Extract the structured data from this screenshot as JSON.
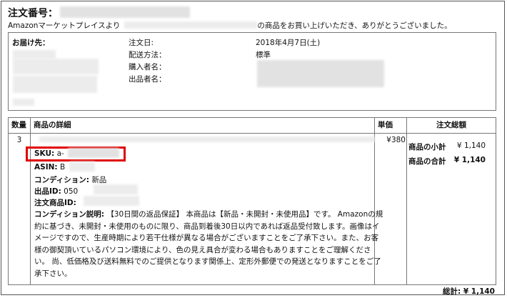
{
  "header": {
    "order_number_label": "注文番号：",
    "thanks_prefix": "Amazonマーケットプレイスより",
    "thanks_suffix": "の商品をお買い上げいただき、ありがとうございました。"
  },
  "shipping": {
    "ship_to_label": "お届け先：",
    "order_date_label": "注文日:",
    "order_date_value": "2018年4月7日(土)",
    "shipping_method_label": "配送方法：",
    "shipping_method_value": "標準",
    "purchaser_label": "購入者名：",
    "seller_label": "出品者名："
  },
  "table": {
    "headers": {
      "qty": "数量",
      "detail": "商品の詳細",
      "unit_price": "単価",
      "total": "注文総額"
    },
    "row": {
      "qty": "3",
      "unit_price": "¥380",
      "sku_label": "SKU:",
      "sku_value": "a-",
      "asin_label": "ASIN:",
      "asin_value": "B",
      "condition_label": "コンディション:",
      "condition_value": "新品",
      "listing_id_label": "出品ID:",
      "listing_id_value": "050",
      "order_item_id_label": "注文商品ID:",
      "condition_desc_label": "コンディション説明:",
      "condition_desc_text": "【30日間の返品保証】 本商品は【新品・未開封・未使用品】です。 Amazonの規約に基づき、未開封・未使用のものに限り、商品到着後30日以内であれば返品受付致します。画像はイメージですので、生産時期により若干仕様が異なる場合がございますことをご了承下さい。また、お客様の御契頂いているパソコン環境により、色の見え具合が変わる場合もありますことをご理解ください。 尚、低価格及び送料無料でのご提供となります関係上、定形外郵便での発送となりますことをご了承下さい。"
    },
    "totals": {
      "subtotal_label": "商品の小計",
      "subtotal_value": "¥ 1,140",
      "total_label": "商品の合計",
      "total_value": "¥ 1,140"
    }
  },
  "footer": {
    "grand_total_label": "総計:",
    "grand_total_value": "¥ 1,140"
  },
  "colors": {
    "highlight": "#e00000"
  }
}
